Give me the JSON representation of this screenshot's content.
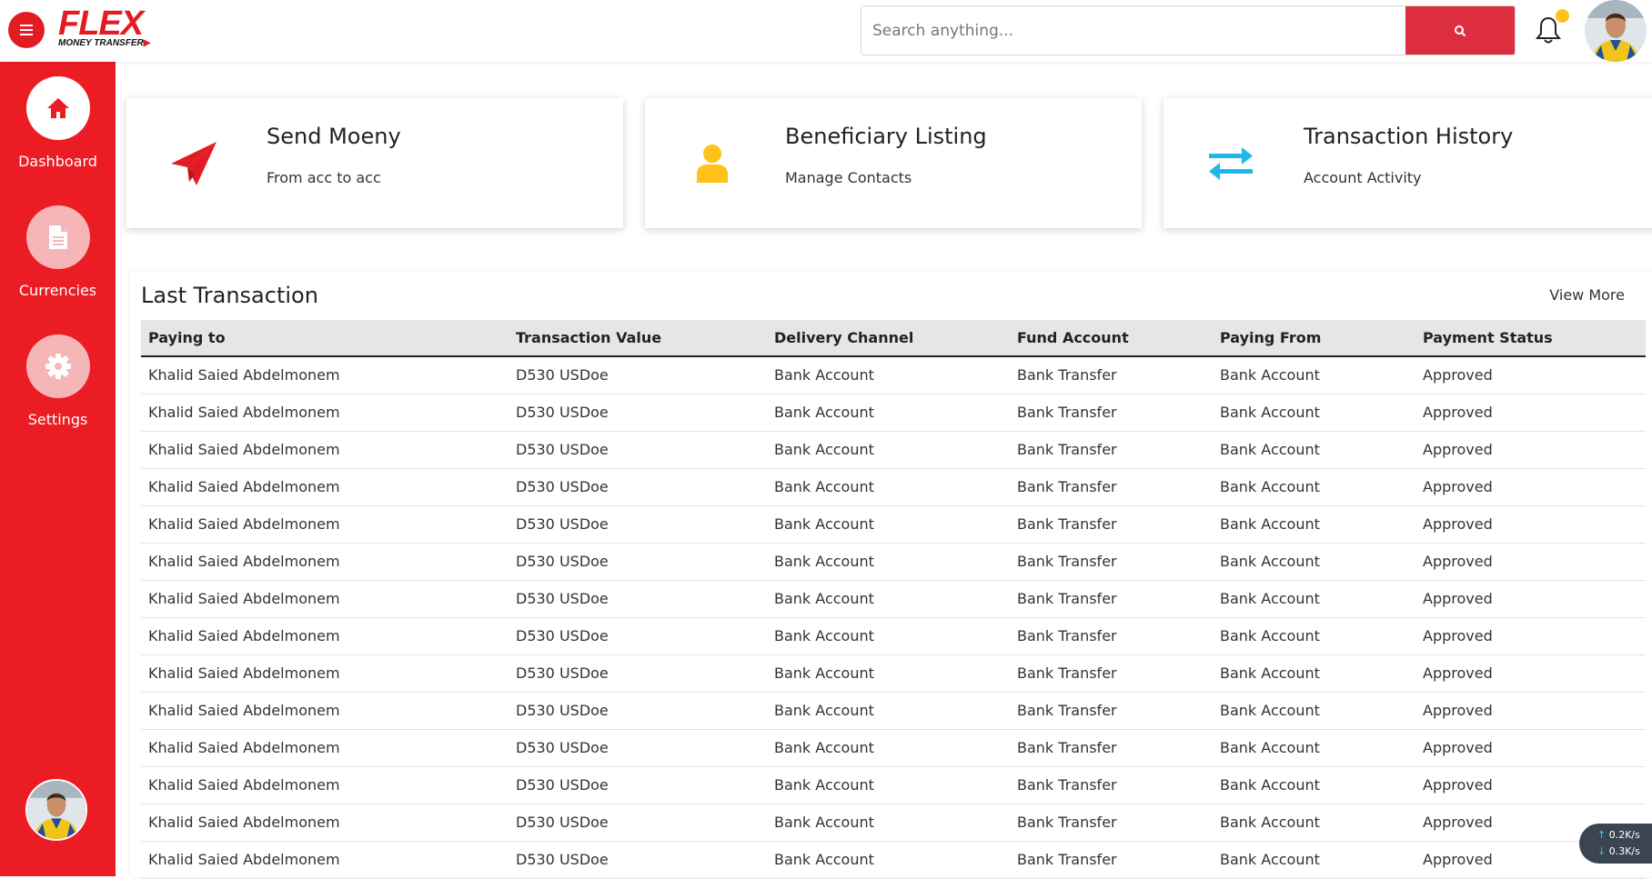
{
  "brand": {
    "name": "FLEX",
    "tagline": "MONEY TRANSFER"
  },
  "search": {
    "placeholder": "Search anything..."
  },
  "sidebar": {
    "items": [
      {
        "label": "Dashboard",
        "icon": "home-icon",
        "active": true
      },
      {
        "label": "Currencies",
        "icon": "document-icon",
        "active": false
      },
      {
        "label": "Settings",
        "icon": "gear-icon",
        "active": false
      }
    ]
  },
  "cards": [
    {
      "title": "Send Moeny",
      "subtitle": "From acc to acc",
      "icon": "paper-plane-icon",
      "color": "#e31c23"
    },
    {
      "title": "Beneficiary Listing",
      "subtitle": "Manage Contacts",
      "icon": "user-icon",
      "color": "#ffc21a"
    },
    {
      "title": "Transaction History",
      "subtitle": "Account Activity",
      "icon": "swap-arrows-icon",
      "color": "#20b8e8"
    }
  ],
  "transactions": {
    "title": "Last Transaction",
    "view_more": "View More",
    "columns": [
      "Paying to",
      "Transaction Value",
      "Delivery Channel",
      "Fund Account",
      "Paying From",
      "Payment Status"
    ],
    "rows": [
      [
        "Khalid Saied Abdelmonem",
        "D530 USDoe",
        "Bank Account",
        "Bank Transfer",
        "Bank Account",
        "Approved"
      ],
      [
        "Khalid Saied Abdelmonem",
        "D530 USDoe",
        "Bank Account",
        "Bank Transfer",
        "Bank Account",
        "Approved"
      ],
      [
        "Khalid Saied Abdelmonem",
        "D530 USDoe",
        "Bank Account",
        "Bank Transfer",
        "Bank Account",
        "Approved"
      ],
      [
        "Khalid Saied Abdelmonem",
        "D530 USDoe",
        "Bank Account",
        "Bank Transfer",
        "Bank Account",
        "Approved"
      ],
      [
        "Khalid Saied Abdelmonem",
        "D530 USDoe",
        "Bank Account",
        "Bank Transfer",
        "Bank Account",
        "Approved"
      ],
      [
        "Khalid Saied Abdelmonem",
        "D530 USDoe",
        "Bank Account",
        "Bank Transfer",
        "Bank Account",
        "Approved"
      ],
      [
        "Khalid Saied Abdelmonem",
        "D530 USDoe",
        "Bank Account",
        "Bank Transfer",
        "Bank Account",
        "Approved"
      ],
      [
        "Khalid Saied Abdelmonem",
        "D530 USDoe",
        "Bank Account",
        "Bank Transfer",
        "Bank Account",
        "Approved"
      ],
      [
        "Khalid Saied Abdelmonem",
        "D530 USDoe",
        "Bank Account",
        "Bank Transfer",
        "Bank Account",
        "Approved"
      ],
      [
        "Khalid Saied Abdelmonem",
        "D530 USDoe",
        "Bank Account",
        "Bank Transfer",
        "Bank Account",
        "Approved"
      ],
      [
        "Khalid Saied Abdelmonem",
        "D530 USDoe",
        "Bank Account",
        "Bank Transfer",
        "Bank Account",
        "Approved"
      ],
      [
        "Khalid Saied Abdelmonem",
        "D530 USDoe",
        "Bank Account",
        "Bank Transfer",
        "Bank Account",
        "Approved"
      ],
      [
        "Khalid Saied Abdelmonem",
        "D530 USDoe",
        "Bank Account",
        "Bank Transfer",
        "Bank Account",
        "Approved"
      ],
      [
        "Khalid Saied Abdelmonem",
        "D530 USDoe",
        "Bank Account",
        "Bank Transfer",
        "Bank Account",
        "Approved"
      ]
    ]
  },
  "net_widget": {
    "up": "0.2K/s",
    "down": "0.3K/s"
  },
  "colors": {
    "brand_red": "#e31c23",
    "sidebar_red": "#ec1c24",
    "search_button": "#dc2e3e",
    "notification_dot": "#ffc21a"
  }
}
